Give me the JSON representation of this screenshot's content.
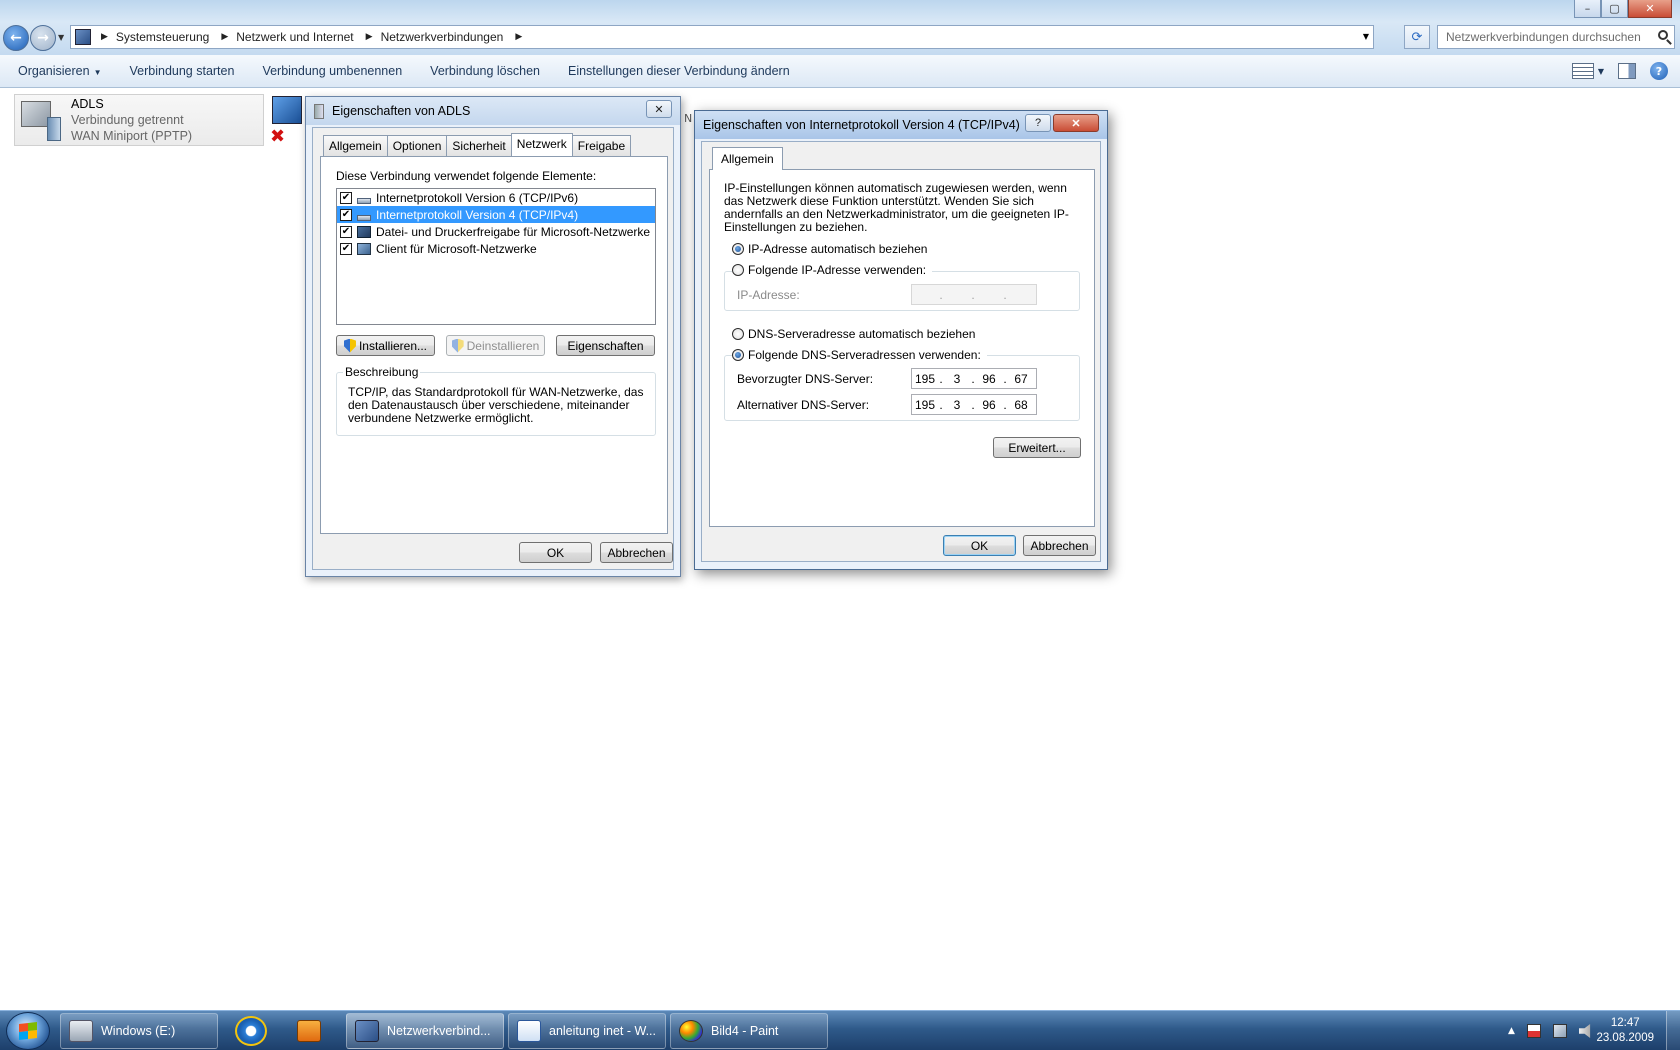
{
  "explorer": {
    "breadcrumbs": [
      "Systemsteuerung",
      "Netzwerk und Internet",
      "Netzwerkverbindungen"
    ],
    "search_placeholder": "Netzwerkverbindungen durchsuchen",
    "commands": [
      "Organisieren",
      "Verbindung starten",
      "Verbindung umbenennen",
      "Verbindung löschen",
      "Einstellungen dieser Verbindung ändern"
    ],
    "connection": {
      "name": "ADLS",
      "status": "Verbindung getrennt",
      "device": "WAN Miniport (PPTP)"
    }
  },
  "adls_dialog": {
    "title": "Eigenschaften von ADLS",
    "tabs": [
      "Allgemein",
      "Optionen",
      "Sicherheit",
      "Netzwerk",
      "Freigabe"
    ],
    "active_tab": "Netzwerk",
    "elements_label": "Diese Verbindung verwendet folgende Elemente:",
    "items": [
      {
        "label": "Internetprotokoll Version 6 (TCP/IPv6)",
        "checked": true,
        "icon": "protocol-icon"
      },
      {
        "label": "Internetprotokoll Version 4 (TCP/IPv4)",
        "checked": true,
        "selected": true,
        "icon": "protocol-icon"
      },
      {
        "label": "Datei- und Druckerfreigabe für Microsoft-Netzwerke",
        "checked": true,
        "icon": "file-share-icon"
      },
      {
        "label": "Client für Microsoft-Netzwerke",
        "checked": true,
        "icon": "client-icon"
      }
    ],
    "buttons": {
      "install": "Installieren...",
      "uninstall": "Deinstallieren",
      "properties": "Eigenschaften"
    },
    "description_title": "Beschreibung",
    "description": "TCP/IP, das Standardprotokoll für WAN-Netzwerke, das den Datenaustausch über verschiedene, miteinander verbundene Netzwerke ermöglicht.",
    "ok": "OK",
    "cancel": "Abbrechen"
  },
  "ipv4_dialog": {
    "title": "Eigenschaften von Internetprotokoll Version 4 (TCP/IPv4)",
    "tab": "Allgemein",
    "intro": "IP-Einstellungen können automatisch zugewiesen werden, wenn das Netzwerk diese Funktion unterstützt. Wenden Sie sich andernfalls an den Netzwerkadministrator, um die geeigneten IP-Einstellungen zu beziehen.",
    "ip_auto": "IP-Adresse automatisch beziehen",
    "ip_manual": "Folgende IP-Adresse verwenden:",
    "ip_label": "IP-Adresse:",
    "dns_auto": "DNS-Serveradresse automatisch beziehen",
    "dns_manual": "Folgende DNS-Serveradressen verwenden:",
    "preferred_label": "Bevorzugter DNS-Server:",
    "preferred_dns": [
      "195",
      "3",
      "96",
      "67"
    ],
    "alternate_label": "Alternativer DNS-Server:",
    "alternate_dns": [
      "195",
      "3",
      "96",
      "68"
    ],
    "advanced": "Erweitert...",
    "ok": "OK",
    "cancel": "Abbrechen"
  },
  "taskbar": {
    "items": [
      "Windows (E:)",
      "Netzwerkverbind...",
      "anleitung inet - W...",
      "Bild4 - Paint"
    ],
    "time": "12:47",
    "date": "23.08.2009"
  }
}
